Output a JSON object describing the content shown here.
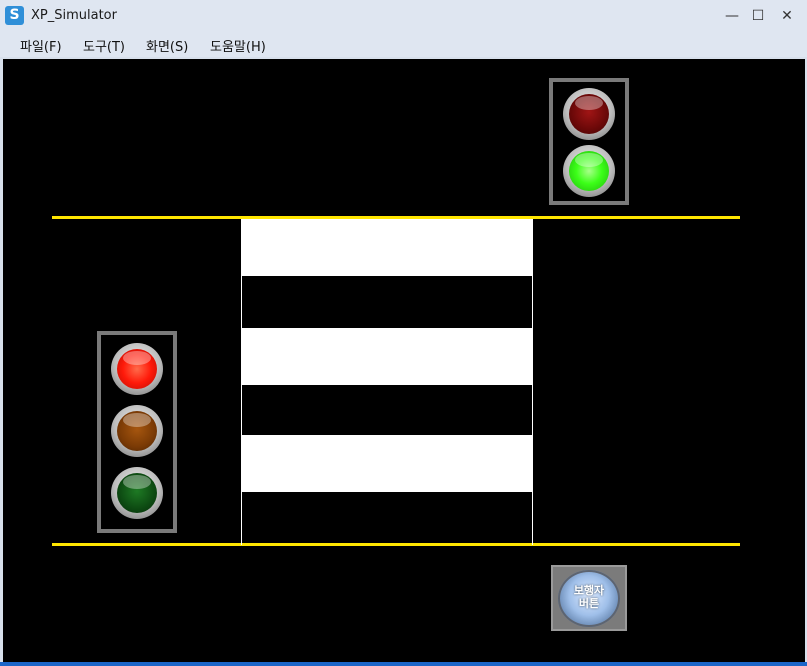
{
  "window": {
    "title": "XP_Simulator",
    "icon_letter": "S",
    "controls": {
      "minimize": "—",
      "maximize": "☐",
      "close": "✕"
    }
  },
  "menu": [
    {
      "label": "파일(F)"
    },
    {
      "label": "도구(T)"
    },
    {
      "label": "화면(S)"
    },
    {
      "label": "도움말(H)"
    }
  ],
  "scene": {
    "vehicle_signal": {
      "lamps": [
        "red",
        "green"
      ],
      "active": "green"
    },
    "pedestrian_signal": {
      "lamps": [
        "red",
        "amber",
        "green"
      ],
      "active": "red"
    },
    "crosswalk_stripes": 3,
    "pedestrian_button": {
      "line1": "보행자",
      "line2": "버튼"
    }
  },
  "colors": {
    "road_line": "#ffe600",
    "canvas": "#000000",
    "red_on": "#ff1a0a",
    "red_off": "#6a0808",
    "amber_off": "#7a3a05",
    "green_on": "#3cff18",
    "green_off": "#0d4a12"
  }
}
